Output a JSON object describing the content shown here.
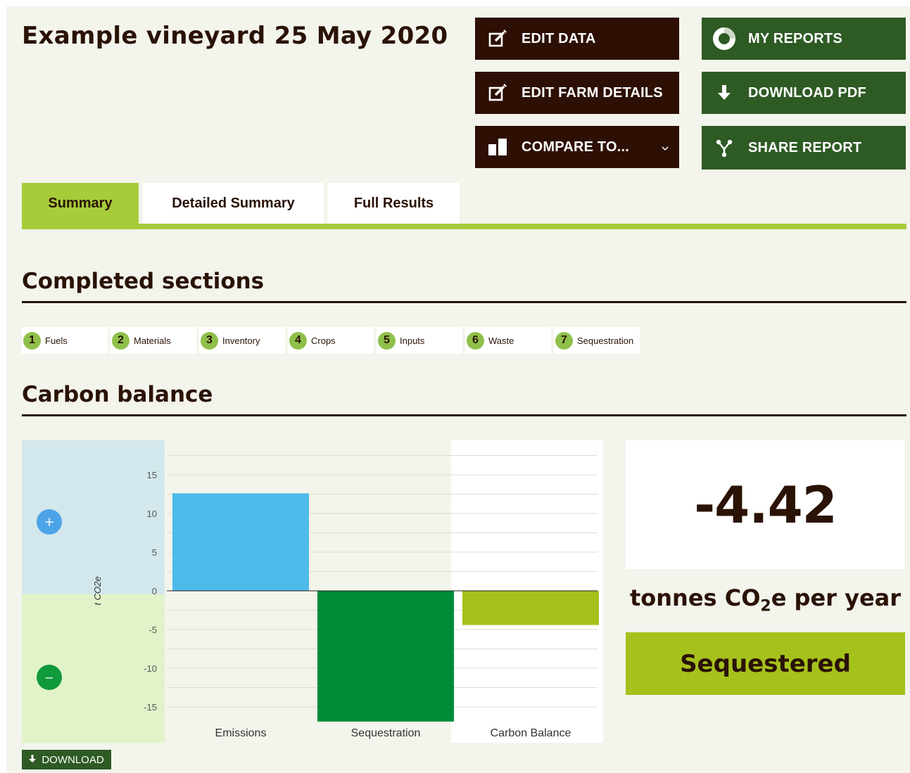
{
  "page_title": "Example vineyard 25 May 2020",
  "actions": {
    "edit_data": "EDIT DATA",
    "edit_farm_details": "EDIT FARM DETAILS",
    "compare_to": "COMPARE TO...",
    "my_reports": "MY REPORTS",
    "download_pdf": "DOWNLOAD PDF",
    "share_report": "SHARE REPORT"
  },
  "tabs": [
    {
      "label": "Summary",
      "active": true
    },
    {
      "label": "Detailed Summary",
      "active": false
    },
    {
      "label": "Full Results",
      "active": false
    }
  ],
  "completed_sections": {
    "heading": "Completed sections",
    "items": [
      {
        "num": "1",
        "label": "Fuels"
      },
      {
        "num": "2",
        "label": "Materials"
      },
      {
        "num": "3",
        "label": "Inventory"
      },
      {
        "num": "4",
        "label": "Crops"
      },
      {
        "num": "5",
        "label": "Inputs"
      },
      {
        "num": "6",
        "label": "Waste"
      },
      {
        "num": "7",
        "label": "Sequestration"
      }
    ]
  },
  "carbon_balance": {
    "heading": "Carbon balance",
    "value": "-4.42",
    "units_prefix": "tonnes CO",
    "units_sub": "2",
    "units_suffix": "e per year",
    "status": "Sequestered",
    "download_label": "DOWNLOAD",
    "plus_symbol": "+",
    "minus_symbol": "−"
  },
  "chart_data": {
    "type": "bar",
    "categories": [
      "Emissions",
      "Sequestration",
      "Carbon Balance"
    ],
    "values": [
      12.6,
      -16.9,
      -4.42
    ],
    "colors": [
      "#4dbbea",
      "#008c37",
      "#a5c11c"
    ],
    "ylabel": "t CO2e",
    "ylim": [
      -17,
      17
    ],
    "yticks": [
      15,
      10,
      5,
      0,
      -5,
      -10,
      -15
    ],
    "grid": true
  }
}
